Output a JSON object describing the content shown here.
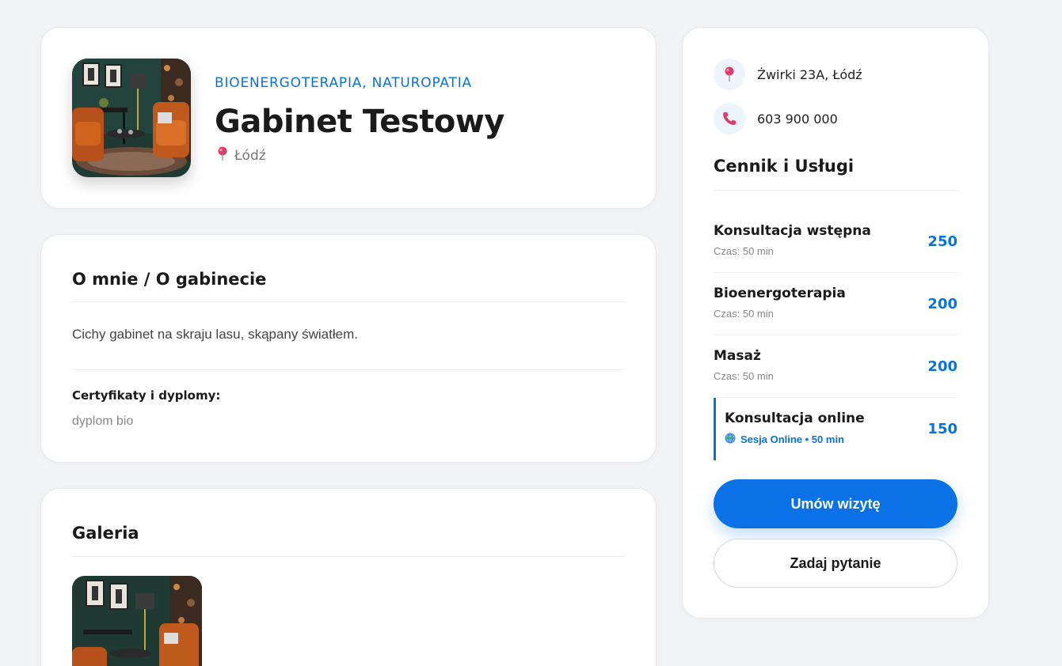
{
  "header": {
    "category": "BIOENERGOTERAPIA, NATUROPATIA",
    "title": "Gabinet Testowy",
    "city": "Łódź",
    "pin_icon": "pin-icon"
  },
  "about": {
    "title": "O mnie / O gabinecie",
    "text": "Cichy gabinet na skraju lasu, skąpany światłem.",
    "cert_label": "Certyfikaty i dyplomy:",
    "cert_value": "dyplom bio"
  },
  "gallery": {
    "title": "Galeria"
  },
  "sidebar": {
    "address": "Żwirki 23A, Łódź",
    "phone": "603 900 000",
    "price_title": "Cennik i Usługi",
    "services": [
      {
        "name": "Konsultacja wstępna",
        "time": "Czas: 50 min",
        "price": "250"
      },
      {
        "name": "Bioenergoterapia",
        "time": "Czas: 50 min",
        "price": "200"
      },
      {
        "name": "Masaż",
        "time": "Czas: 50 min",
        "price": "200"
      },
      {
        "name": "Konsultacja online",
        "time": "Sesja Online • 50 min",
        "price": "150"
      }
    ],
    "book_button": "Umów wizytę",
    "ask_button": "Zadaj pytanie"
  },
  "colors": {
    "accent": "#0a72e6",
    "link": "#0a72d8",
    "background": "#f3f4f6"
  }
}
